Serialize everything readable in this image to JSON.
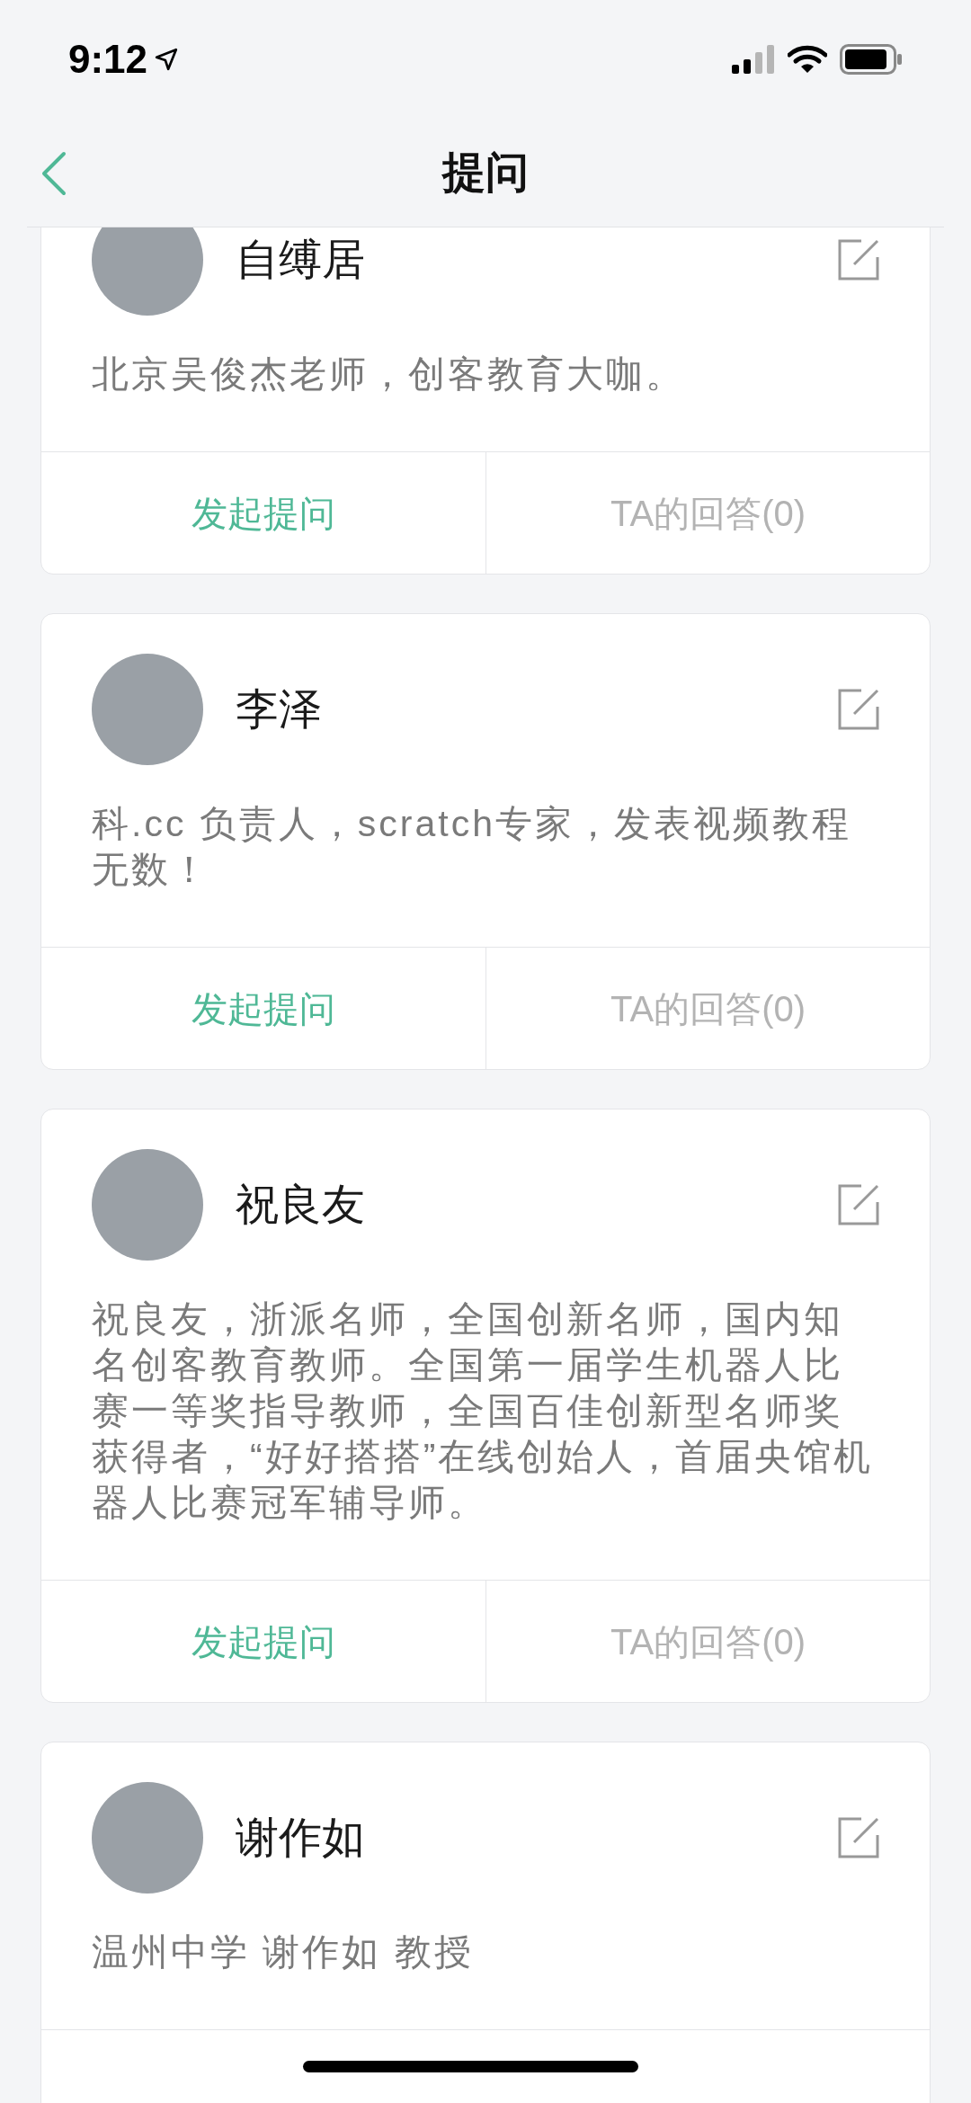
{
  "status_bar": {
    "time": "9:12"
  },
  "nav": {
    "title": "提问"
  },
  "experts": [
    {
      "name": "自缚居",
      "description": "北京吴俊杰老师，创客教育大咖。",
      "actions": [
        "发起提问",
        "TA的回答(0)"
      ]
    },
    {
      "name": "李泽",
      "description": "科.cc  负责人，scratch专家，发表视频教程无数！",
      "actions": [
        "发起提问",
        "TA的回答(0)"
      ]
    },
    {
      "name": "祝良友",
      "description": "祝良友，浙派名师，全国创新名师，国内知名创客教育教师。全国第一届学生机器人比赛一等奖指导教师，全国百佳创新型名师奖获得者，“好好搭搭”在线创始人，首届央馆机器人比赛冠军辅导师。",
      "actions": [
        "发起提问",
        "TA的回答(0)"
      ]
    },
    {
      "name": "谢作如",
      "description": "温州中学 谢作如  教授"
    }
  ]
}
